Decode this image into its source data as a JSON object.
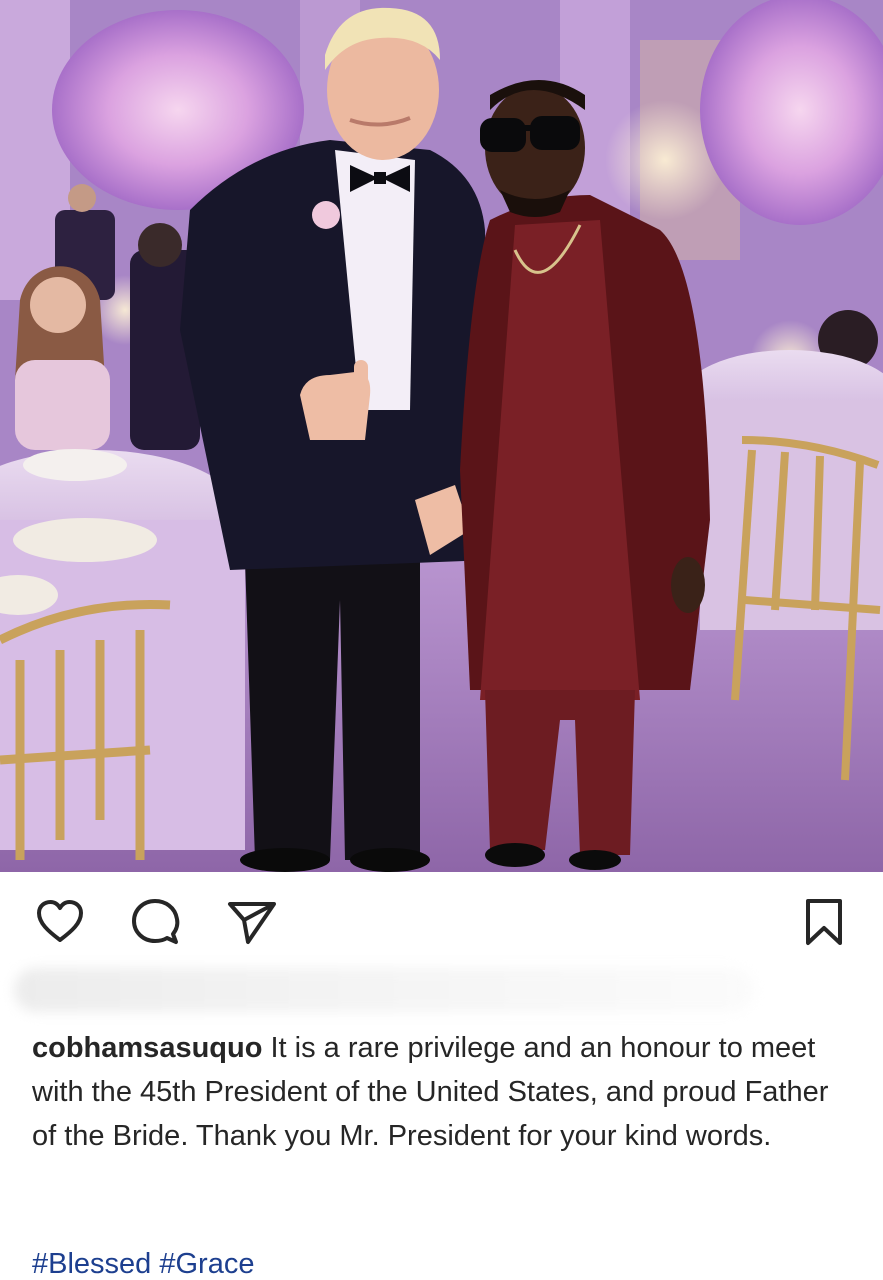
{
  "post": {
    "username": "cobhamsasuquo",
    "caption_text": " It is a rare privilege and an honour to meet with the 45th President of the United States, and proud Father of the Bride. Thank you Mr. President for your kind words.",
    "hashtags": [
      "#Blessed",
      "#Grace"
    ]
  },
  "actions": {
    "like_icon": "heart-icon",
    "comment_icon": "comment-bubble-icon",
    "share_icon": "paper-plane-icon",
    "save_icon": "bookmark-icon"
  },
  "colors": {
    "text": "#262626",
    "hashtag": "#1d3f8f",
    "photo_tint": "#9d77c0"
  }
}
